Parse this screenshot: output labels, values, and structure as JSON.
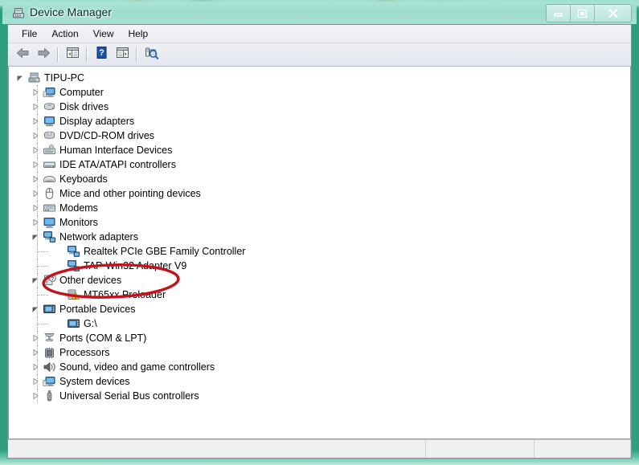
{
  "window": {
    "title": "Device Manager",
    "title_icon": "device-manager-icon",
    "caption_buttons": [
      {
        "name": "minimize-button",
        "glyph": "minimize-icon",
        "label": "Minimize"
      },
      {
        "name": "maximize-button",
        "glyph": "maximize-icon",
        "label": "Maximize"
      },
      {
        "name": "close-button",
        "glyph": "close-icon",
        "label": "Close"
      }
    ]
  },
  "menubar": {
    "items": [
      {
        "label": "File"
      },
      {
        "label": "Action"
      },
      {
        "label": "View"
      },
      {
        "label": "Help"
      }
    ]
  },
  "toolbar": {
    "buttons": [
      {
        "name": "back-button",
        "icon": "back-arrow-icon",
        "tooltip": "Back"
      },
      {
        "name": "forward-button",
        "icon": "forward-arrow-icon",
        "tooltip": "Forward"
      },
      {
        "separator_after": true
      },
      {
        "name": "show-hide-console-tree-button",
        "icon": "console-tree-icon",
        "tooltip": "Show/Hide Console Tree"
      },
      {
        "separator_after": true
      },
      {
        "name": "help-button",
        "icon": "help-question-icon",
        "tooltip": "Help"
      },
      {
        "name": "properties-button",
        "icon": "properties-icon",
        "tooltip": "Properties"
      },
      {
        "separator_after": true
      },
      {
        "name": "scan-for-hardware-changes-button",
        "icon": "scan-hardware-icon",
        "tooltip": "Scan for hardware changes"
      }
    ]
  },
  "tree": {
    "nodes": [
      {
        "label": "TIPU-PC",
        "depth": 0,
        "state": "expanded",
        "icon": "computer-tower-icon"
      },
      {
        "label": "Computer",
        "depth": 1,
        "state": "collapsed",
        "icon": "computer-icon"
      },
      {
        "label": "Disk drives",
        "depth": 1,
        "state": "collapsed",
        "icon": "disk-drive-icon"
      },
      {
        "label": "Display adapters",
        "depth": 1,
        "state": "collapsed",
        "icon": "display-adapter-icon"
      },
      {
        "label": "DVD/CD-ROM drives",
        "depth": 1,
        "state": "collapsed",
        "icon": "dvd-drive-icon"
      },
      {
        "label": "Human Interface Devices",
        "depth": 1,
        "state": "collapsed",
        "icon": "hid-icon"
      },
      {
        "label": "IDE ATA/ATAPI controllers",
        "depth": 1,
        "state": "collapsed",
        "icon": "ide-controller-icon"
      },
      {
        "label": "Keyboards",
        "depth": 1,
        "state": "collapsed",
        "icon": "keyboard-icon"
      },
      {
        "label": "Mice and other pointing devices",
        "depth": 1,
        "state": "collapsed",
        "icon": "mouse-icon"
      },
      {
        "label": "Modems",
        "depth": 1,
        "state": "collapsed",
        "icon": "modem-icon"
      },
      {
        "label": "Monitors",
        "depth": 1,
        "state": "collapsed",
        "icon": "monitor-icon"
      },
      {
        "label": "Network adapters",
        "depth": 1,
        "state": "expanded",
        "icon": "network-adapter-icon"
      },
      {
        "label": "Realtek PCIe GBE Family Controller",
        "depth": 2,
        "state": "leaf",
        "icon": "network-adapter-icon"
      },
      {
        "label": "TAP-Win32 Adapter V9",
        "depth": 2,
        "state": "leaf",
        "icon": "network-adapter-icon"
      },
      {
        "label": "Other devices",
        "depth": 1,
        "state": "expanded",
        "icon": "unknown-device-icon"
      },
      {
        "label": "MT65xx Preloader",
        "depth": 2,
        "state": "leaf",
        "icon": "unknown-device-warning-icon",
        "warning": true
      },
      {
        "label": "Portable Devices",
        "depth": 1,
        "state": "expanded",
        "icon": "portable-device-icon"
      },
      {
        "label": "G:\\",
        "depth": 2,
        "state": "leaf",
        "icon": "portable-device-icon"
      },
      {
        "label": "Ports (COM & LPT)",
        "depth": 1,
        "state": "collapsed",
        "icon": "port-icon"
      },
      {
        "label": "Processors",
        "depth": 1,
        "state": "collapsed",
        "icon": "processor-icon"
      },
      {
        "label": "Sound, video and game controllers",
        "depth": 1,
        "state": "collapsed",
        "icon": "sound-icon"
      },
      {
        "label": "System devices",
        "depth": 1,
        "state": "collapsed",
        "icon": "system-device-icon"
      },
      {
        "label": "Universal Serial Bus controllers",
        "depth": 1,
        "state": "collapsed",
        "icon": "usb-icon"
      }
    ]
  },
  "annotation": {
    "shape": "ellipse",
    "target_label": "MT65xx Preloader",
    "color": "#c4121a",
    "stroke_width": 3
  },
  "statusbar": {
    "pane_main": "",
    "pane_2": "",
    "pane_3": ""
  },
  "colors": {
    "frame_green": "#2f9e7e",
    "titlebar_aqua": "#a3e0d2",
    "annotation_red": "#c4121a",
    "tree_background": "#ffffff",
    "menubar": "#eceef4"
  }
}
